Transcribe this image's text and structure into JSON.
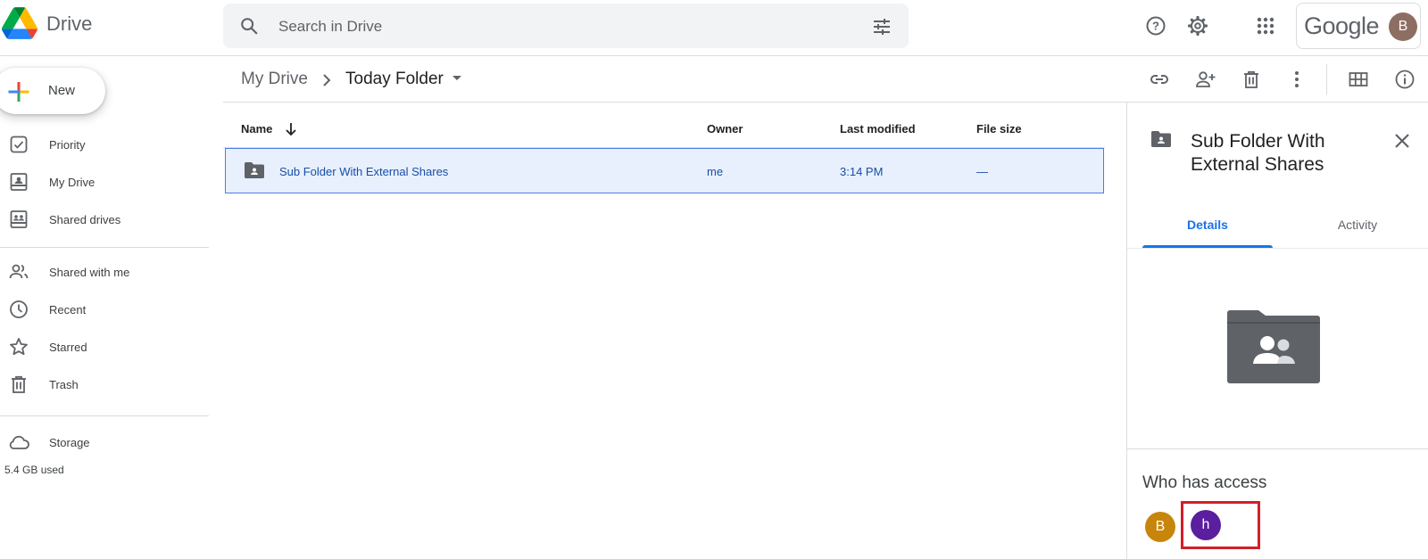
{
  "app": {
    "product": "Drive",
    "brand": "Google",
    "account_initial": "B"
  },
  "search": {
    "placeholder": "Search in Drive"
  },
  "header_icons": [
    "help-icon",
    "settings-icon",
    "apps-grid-icon"
  ],
  "sidebar": {
    "new_label": "New",
    "items": [
      {
        "label": "Priority",
        "icon": "priority-check-icon"
      },
      {
        "label": "My Drive",
        "icon": "my-drive-icon"
      },
      {
        "label": "Shared drives",
        "icon": "shared-drives-icon"
      },
      {
        "label": "Shared with me",
        "icon": "people-icon"
      },
      {
        "label": "Recent",
        "icon": "clock-icon"
      },
      {
        "label": "Starred",
        "icon": "star-icon"
      },
      {
        "label": "Trash",
        "icon": "trash-icon"
      }
    ],
    "storage": {
      "label": "Storage",
      "used": "5.4 GB used"
    }
  },
  "breadcrumb": {
    "root": "My Drive",
    "current": "Today Folder"
  },
  "toolbar_icons": [
    "link-icon",
    "add-person-icon",
    "trash-icon",
    "more-vert-icon",
    "grid-view-icon",
    "info-icon"
  ],
  "file_list": {
    "columns": [
      "Name",
      "Owner",
      "Last modified",
      "File size"
    ],
    "rows": [
      {
        "name": "Sub Folder With External Shares",
        "owner": "me",
        "modified": "3:14 PM",
        "size": "—",
        "selected": true
      }
    ]
  },
  "details": {
    "title": "Sub Folder With External Shares",
    "tabs": [
      "Details",
      "Activity"
    ],
    "active_tab": "Details",
    "who_has_access_label": "Who has access",
    "access_avatars": [
      {
        "initial": "B",
        "color": "#c7860b"
      },
      {
        "initial": "h",
        "color": "#5b1e9e"
      }
    ]
  },
  "colors": {
    "accent": "#1a73e8",
    "selection": "#e8f0fe",
    "highlight_box": "#d21f28"
  }
}
